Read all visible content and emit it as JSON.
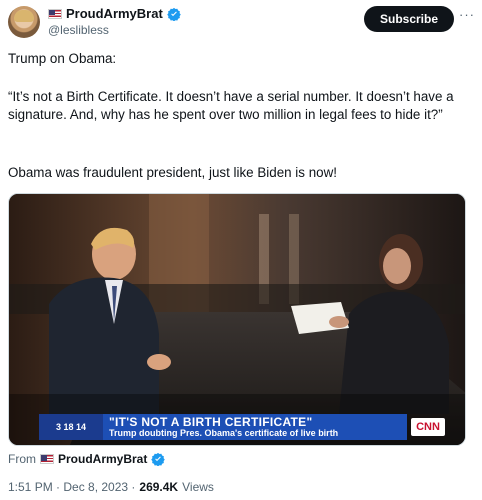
{
  "author": {
    "display_name": "ProudArmyBrat",
    "handle": "@leslibless"
  },
  "actions": {
    "subscribe_label": "Subscribe",
    "more_label": "···"
  },
  "tweet": {
    "line1": "Trump on Obama:",
    "quote": "“It’s not a Birth Certificate. It doesn’t have a serial number. It doesn’t have a signature. And, why has he spent over two million in legal fees to hide it?”",
    "line3": "Obama was fraudulent president, just like Biden is now!"
  },
  "media": {
    "time_text": "3 18 14",
    "headline": "\"IT'S NOT A BIRTH CERTIFICATE\"",
    "subline": "Trump doubting Pres. Obama's certificate of live birth",
    "logo": "CNN"
  },
  "source": {
    "from_label": "From",
    "from_name": "ProudArmyBrat"
  },
  "meta": {
    "timestamp": "1:51 PM · Dec 8, 2023 ·",
    "views_count": "269.4K",
    "views_label": "Views"
  },
  "colors": {
    "verified": "#1d9bf0",
    "text": "#0f1419",
    "secondary": "#536471",
    "cnn_red": "#c8102e"
  }
}
